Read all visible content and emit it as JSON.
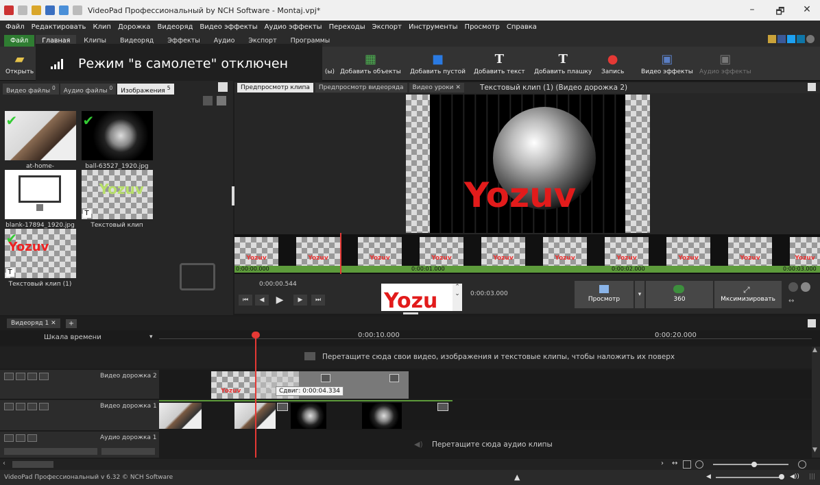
{
  "window": {
    "title": "VideoPad Профессиональный by NCH Software - Montaj.vpj*",
    "minimize": "–",
    "maximize": "🗗",
    "close": "✕"
  },
  "menu": [
    "Файл",
    "Редактировать",
    "Клип",
    "Дорожка",
    "Видеоряд",
    "Видео эффекты",
    "Аудио эффекты",
    "Переходы",
    "Экспорт",
    "Инструменты",
    "Просмотр",
    "Справка"
  ],
  "ribbon_tabs": [
    "Файл",
    "Главная",
    "Клипы",
    "Видеоряд",
    "Эффекты",
    "Аудио",
    "Экспорт",
    "Программы"
  ],
  "toolbar": {
    "open": "Открыть",
    "partial_label": "(ы)",
    "add_objects": "Добавить объекты",
    "add_blank": "Добавить пустой",
    "add_text": "Добавить текст",
    "add_plate": "Добавить плашку",
    "record": "Запись",
    "video_effects": "Видео эффекты",
    "audio_effects": "Аудио эффекты"
  },
  "notification": "Режим \"в самолете\" отключен",
  "bin": {
    "tabs": [
      "Видео файлы",
      "Аудио файлы",
      "Изображения"
    ],
    "tab_counts": [
      "0",
      "0",
      "5"
    ],
    "items": [
      {
        "name": "at-home-4013247_19...",
        "used": true
      },
      {
        "name": "ball-63527_1920.jpg",
        "used": true
      },
      {
        "name": "blank-17894_1920.jpg",
        "used": false
      },
      {
        "name": "Текстовый клип",
        "used": false,
        "text": "Yozuv"
      },
      {
        "name": "Текстовый клип (1)",
        "used": true,
        "text": "Yozuv"
      }
    ]
  },
  "preview": {
    "tabs": [
      "Предпросмотр клипа",
      "Предпросмотр видеоряда",
      "Видео уроки ✕"
    ],
    "clip_title": "Текстовый клип (1) (Видео дорожка 2)",
    "overlay_text": "Yozuv",
    "frame_label": "Yozuv",
    "times": [
      "0:00:00.000",
      "0:00:01.000",
      "0:00:02.000",
      "0:00:03.000"
    ],
    "current_time": "0:00:00.544",
    "duration": "0:00:03.000",
    "thumb_text": "Yozu",
    "btn_view": "Просмотр",
    "btn_360": "360",
    "btn_maximize": "Мксимизировать"
  },
  "timeline": {
    "tab": "Видеоряд 1",
    "scale_label": "Шкала времени",
    "marks": [
      "0:00:10.000",
      "0:00:20.000"
    ],
    "overlay_hint": "Перетащите сюда свои видео, изображения и текстовые клипы, чтобы наложить их поверх",
    "tracks": [
      {
        "name": "Видео дорожка 2"
      },
      {
        "name": "Видео дорожка 1"
      },
      {
        "name": "Аудио дорожка 1"
      }
    ],
    "audio_hint": "Перетащите сюда аудио клипы",
    "tooltip": "Сдвиг: 0:00:04.334",
    "clip_text": "Yozuv"
  },
  "status": "VideoPad Профессиональный v 6.32 © NCH Software"
}
